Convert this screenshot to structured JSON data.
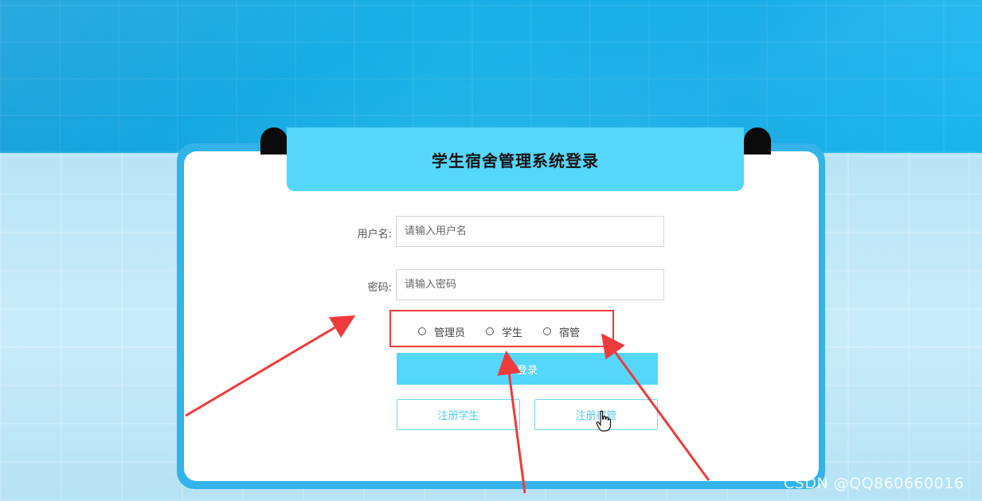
{
  "page": {
    "title": "学生宿舍管理系统登录"
  },
  "form": {
    "username_label": "用户名:",
    "username_placeholder": "请输入用户名",
    "password_label": "密码:",
    "password_placeholder": "请输入密码"
  },
  "roles": [
    {
      "label": "管理员",
      "selected": false
    },
    {
      "label": "学生",
      "selected": false
    },
    {
      "label": "宿管",
      "selected": false
    }
  ],
  "buttons": {
    "login_label": "登录",
    "register_student_label": "注册学生",
    "register_manager_label": "注册宿管"
  },
  "annotation": {
    "highlight_color": "#ef3b3b",
    "arrow_color": "#ef3b3b"
  },
  "watermark": "CSDN @QQ860660016",
  "colors": {
    "accent": "#55d6fb",
    "frame": "#33b3e8",
    "background_top": "#18b1e6"
  },
  "icons": {
    "cursor": "hand-pointer-icon"
  }
}
